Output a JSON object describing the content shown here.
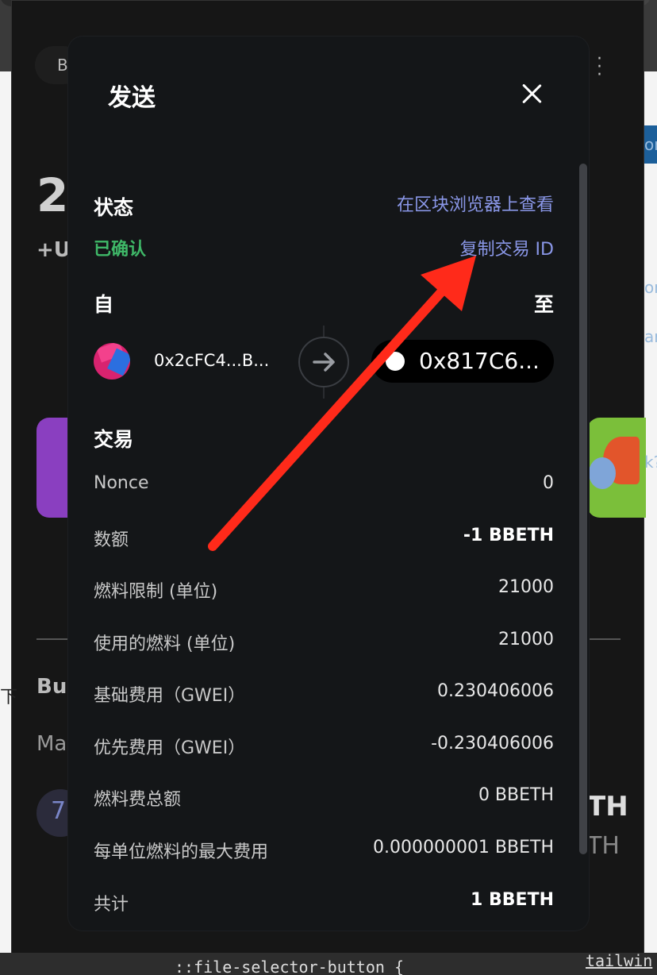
{
  "background": {
    "tab_pill_text": "B",
    "big_number": "2",
    "sub_text": "+U",
    "section_bu": "Bu",
    "section_ma": "Ma",
    "avatar_glyph": "7",
    "th_bold": "TH",
    "th_light": "TH",
    "left_glyph": "下",
    "side_text_1": "on",
    "side_text_2": "on",
    "side_text_3": "ar",
    "side_text_4": "k?",
    "code_text": "::file-selector-button {",
    "code_text_2": "tailwin"
  },
  "modal": {
    "title": "发送",
    "status": {
      "label": "状态",
      "value": "已确认",
      "value_color": "#3fb868",
      "explorer_link": "在区块浏览器上查看",
      "copy_link": "复制交易 ID",
      "link_color": "#8a97e8"
    },
    "from": {
      "label": "自",
      "address": "0x2cFC4...B..."
    },
    "to": {
      "label": "至",
      "address": "0x817C6..."
    },
    "transaction": {
      "heading": "交易",
      "rows": [
        {
          "label": "Nonce",
          "value": "0"
        },
        {
          "label": "数额",
          "value": "-1 BBETH"
        },
        {
          "label": "燃料限制 (单位)",
          "value": "21000"
        },
        {
          "label": "使用的燃料 (单位)",
          "value": "21000"
        },
        {
          "label": "基础费用（GWEI）",
          "value": "0.230406006"
        },
        {
          "label": "优先费用（GWEI）",
          "value": "-0.230406006"
        },
        {
          "label": "燃料费总额",
          "value": "0 BBETH"
        },
        {
          "label": "每单位燃料的最大费用",
          "value": "0.000000001 BBETH"
        },
        {
          "label": "共计",
          "value": "1 BBETH"
        }
      ]
    }
  },
  "annotation": {
    "arrow_color": "#ff2a1a"
  }
}
